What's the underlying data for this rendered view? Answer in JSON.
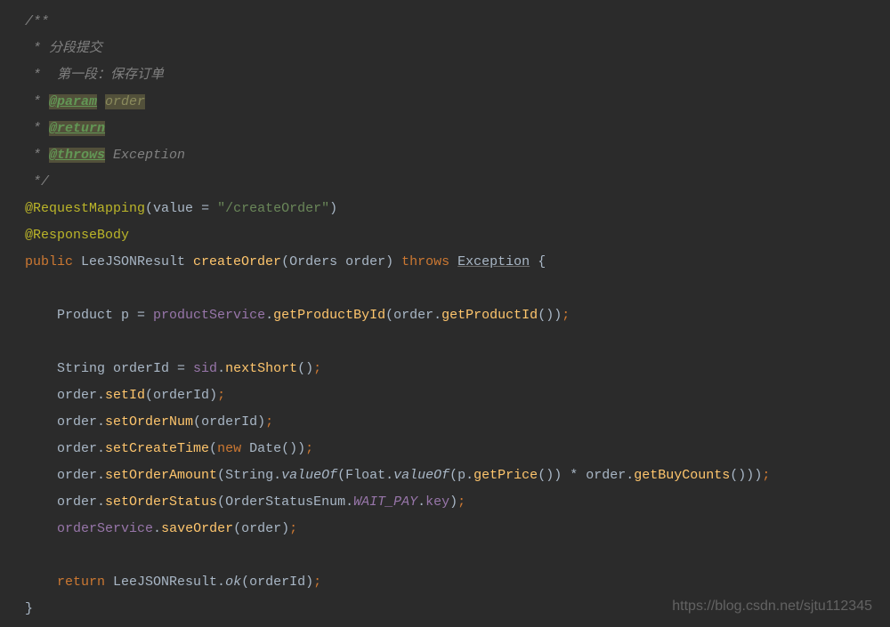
{
  "doc": {
    "start": "/**",
    "l1": " * 分段提交",
    "l2": " *  第一段：保存订单",
    "l3_pre": " * ",
    "l3_tag": "@param",
    "l3_space": " ",
    "l3_name": "order",
    "l4_pre": " * ",
    "l4_tag": "@return",
    "l5_pre": " * ",
    "l5_tag": "@throws",
    "l5_rest": " Exception",
    "end": " */"
  },
  "ann1_name": "@RequestMapping",
  "ann1_lp": "(",
  "ann1_attr": "value ",
  "ann1_eq": "= ",
  "ann1_val": "\"/createOrder\"",
  "ann1_rp": ")",
  "ann2": "@ResponseBody",
  "sig_public": "public ",
  "sig_ret": "LeeJSONResult ",
  "sig_name": "createOrder",
  "sig_lp": "(",
  "sig_ptype": "Orders ",
  "sig_pname": "order",
  "sig_rp": ")",
  "sig_sp": " ",
  "sig_throws": "throws ",
  "sig_exc": "Exception",
  "sig_brace": " {",
  "b1_indent": "    Product p ",
  "b1_eq": "= ",
  "b1_svc": "productService",
  "b1_dot": ".",
  "b1_m1": "getProductById",
  "b1_lp1": "(",
  "b1_obj": "order.",
  "b1_m2": "getProductId",
  "b1_lp2": "()",
  "b1_rp": ")",
  "b1_semi": ";",
  "b2_indent": "    String orderId ",
  "b2_eq": "= ",
  "b2_svc": "sid",
  "b2_dot": ".",
  "b2_m": "nextShort",
  "b2_p": "()",
  "b2_semi": ";",
  "b3": "    order.",
  "b3_m": "setId",
  "b3_lp": "(",
  "b3_arg": "orderId",
  "b3_rp": ")",
  "b3_semi": ";",
  "b4": "    order.",
  "b4_m": "setOrderNum",
  "b4_lp": "(",
  "b4_arg": "orderId",
  "b4_rp": ")",
  "b4_semi": ";",
  "b5": "    order.",
  "b5_m": "setCreateTime",
  "b5_lp": "(",
  "b5_new": "new ",
  "b5_cls": "Date",
  "b5_p": "()",
  "b5_rp": ")",
  "b5_semi": ";",
  "b6": "    order.",
  "b6_m": "setOrderAmount",
  "b6_lp": "(",
  "b6_s": "String.",
  "b6_vo": "valueOf",
  "b6_lp2": "(",
  "b6_f": "Float.",
  "b6_vo2": "valueOf",
  "b6_lp3": "(",
  "b6_p": "p.",
  "b6_gp": "getPrice",
  "b6_p2": "()",
  "b6_rp3": ")",
  "b6_mul": " * ",
  "b6_o": "order.",
  "b6_gbc": "getBuyCounts",
  "b6_p3": "()",
  "b6_rp2": ")",
  "b6_rp": ")",
  "b6_semi": ";",
  "b7": "    order.",
  "b7_m": "setOrderStatus",
  "b7_lp": "(",
  "b7_enum": "OrderStatusEnum.",
  "b7_val": "WAIT_PAY",
  "b7_dot": ".",
  "b7_key": "key",
  "b7_rp": ")",
  "b7_semi": ";",
  "b8_indent": "    ",
  "b8_svc": "orderService",
  "b8_dot": ".",
  "b8_m": "saveOrder",
  "b8_lp": "(",
  "b8_arg": "order",
  "b8_rp": ")",
  "b8_semi": ";",
  "ret_indent": "    ",
  "ret_kw": "return ",
  "ret_cls": "LeeJSONResult.",
  "ret_m": "ok",
  "ret_lp": "(",
  "ret_arg": "orderId",
  "ret_rp": ")",
  "ret_semi": ";",
  "close_brace": "}",
  "watermark": "https://blog.csdn.net/sjtu112345"
}
